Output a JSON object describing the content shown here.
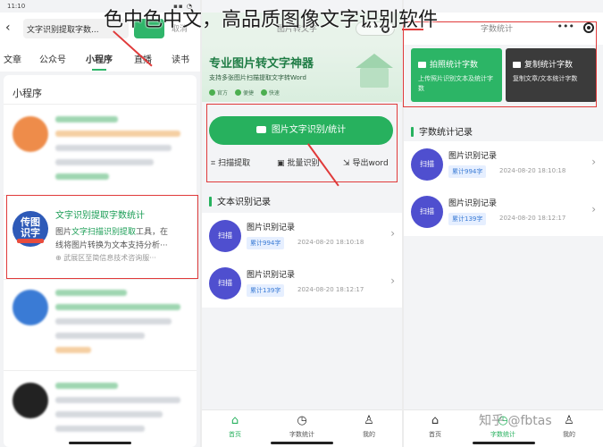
{
  "watermark": "色中色中文，高品质图像文字识别软件",
  "site_watermark": "知乎 @fbtas",
  "panel1": {
    "status_time": "11:10",
    "back_icon": "back-arrow-icon",
    "search_value": "文字识别提取字数...",
    "cancel_label": "取消",
    "tabs": [
      "文章",
      "公众号",
      "小程序",
      "直播",
      "读书"
    ],
    "active_tab": "小程序",
    "section_title": "小程序",
    "focus_entry": {
      "logo_line1": "传图",
      "logo_line2": "识字",
      "name": "文字识别提取字数统计",
      "desc1_plain_a": "图片",
      "desc1_highlight": "文字扫描识别提取",
      "desc1_plain_b": "工具，在",
      "desc2": "线将图片转换为文本支持分析···",
      "location": "武展区至简信息技术咨询服···"
    }
  },
  "panel2": {
    "title": "图片转文字",
    "banner_title": "专业图片转文字神器",
    "banner_sub": "支持多张图片扫描提取文字转Word",
    "badges": [
      "官方",
      "便捷",
      "快速"
    ],
    "main_button": "图片文字识别/统计",
    "actions": [
      {
        "icon": "scan-icon",
        "label": "扫描提取"
      },
      {
        "icon": "batch-icon",
        "label": "批量识别"
      },
      {
        "icon": "export-icon",
        "label": "导出word"
      }
    ],
    "section_title": "文本识别记录",
    "records": [
      {
        "avatar": "扫描",
        "name": "图片识别记录",
        "count": "累计994字",
        "time": "2024-08-20 18:10:18"
      },
      {
        "avatar": "扫描",
        "name": "图片识别记录",
        "count": "累计139字",
        "time": "2024-08-20 18:12:17"
      }
    ],
    "tabbar": [
      {
        "icon": "home-icon",
        "label": "首页",
        "active": true
      },
      {
        "icon": "stats-icon",
        "label": "字数统计",
        "active": false
      },
      {
        "icon": "user-icon",
        "label": "我的",
        "active": false
      }
    ]
  },
  "panel3": {
    "title": "字数统计",
    "tiles": [
      {
        "title": "拍照统计字数",
        "desc": "上传照片识别文本及统计字数",
        "color": "#2cb566"
      },
      {
        "title": "复制统计字数",
        "desc": "复制文章/文本统计字数",
        "color": "#3b3b3b"
      }
    ],
    "section_title": "字数统计记录",
    "records": [
      {
        "avatar": "扫描",
        "name": "图片识别记录",
        "count": "累计994字",
        "time": "2024-08-20 18:10:18"
      },
      {
        "avatar": "扫描",
        "name": "图片识别记录",
        "count": "累计139字",
        "time": "2024-08-20 18:12:17"
      }
    ],
    "tabbar": [
      {
        "icon": "home-icon",
        "label": "首页",
        "active": false
      },
      {
        "icon": "stats-icon",
        "label": "字数统计",
        "active": true
      },
      {
        "icon": "user-icon",
        "label": "我的",
        "active": false
      }
    ]
  }
}
